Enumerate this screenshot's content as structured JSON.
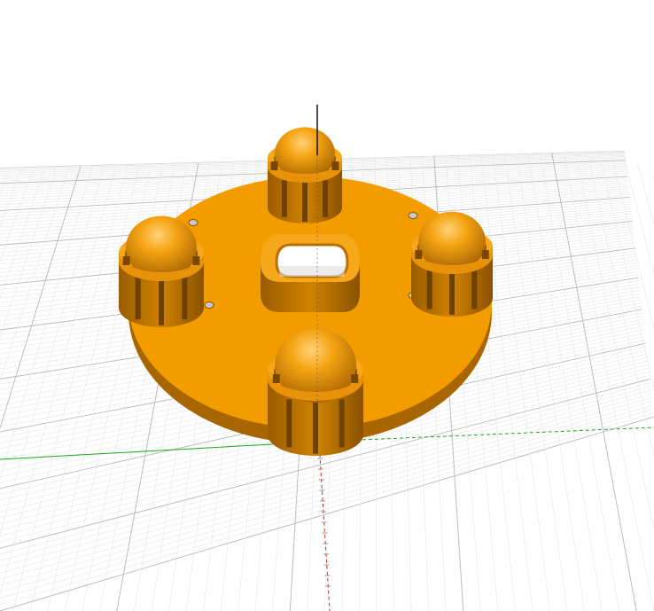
{
  "viewport": {
    "label": "3D model viewer",
    "background": "#ffffff"
  },
  "colors": {
    "model": "#f39c00",
    "model_shadow": "#b86f00",
    "model_dark": "#8a5200",
    "grid_minor": "#e6e6e6",
    "grid_major": "#b8b8b8",
    "x_axis": "#d42a2a",
    "y_axis": "#1fa51f",
    "z_axis": "#111111"
  },
  "model": {
    "name": "round-base-plate",
    "ball_casters": 4,
    "mount_holes": 4,
    "center_cutout": "rounded-rectangle"
  },
  "axes": [
    "x-axis",
    "y-axis",
    "z-axis"
  ],
  "grid": {
    "visible": true
  }
}
